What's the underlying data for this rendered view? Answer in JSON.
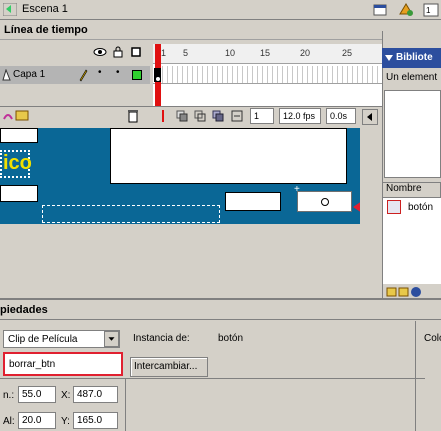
{
  "scene": {
    "label": "Escena 1"
  },
  "timeline": {
    "title": "Línea de tiempo",
    "frame_ticks": [
      "5",
      "10",
      "15",
      "20",
      "25"
    ],
    "first_frame": "1",
    "layer_name": "Capa 1",
    "current_frame": "1",
    "frame_rate": "12.0 fps",
    "elapsed": "0.0s"
  },
  "stage": {
    "partial_text": "ico"
  },
  "library": {
    "title": "Bibliote",
    "item_count_text": "Un element",
    "list_header": "Nombre",
    "items": [
      {
        "label": "botón"
      }
    ]
  },
  "properties": {
    "title": "piedades",
    "symbol_type": "Clip de Película",
    "instance_name": "borrar_btn",
    "instance_of_label": "Instancia de:",
    "instance_of_value": "botón",
    "swap_button": "Intercambiar...",
    "right_label": "Colo",
    "width_label": "n.:",
    "width_value": "55.0",
    "x_label": "X:",
    "x_value": "487.0",
    "height_label": "Al:",
    "height_value": "20.0",
    "y_label": "Y:",
    "y_value": "165.0"
  },
  "colors": {
    "stage_bg": "#0a6796",
    "accent_red": "#e02030",
    "yellow_text": "#f0e000",
    "library_title_bg": "#2c4e9e"
  }
}
